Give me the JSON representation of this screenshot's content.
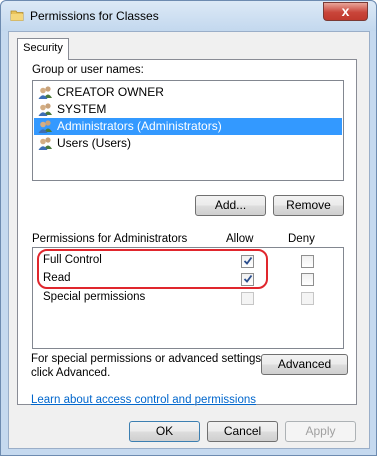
{
  "window": {
    "title": "Permissions for Classes",
    "close_label": "x"
  },
  "tabs": [
    {
      "label": "Security",
      "selected": true
    }
  ],
  "group_list": {
    "label": "Group or user names:",
    "items": [
      {
        "name": "CREATOR OWNER",
        "icon": "users-icon",
        "selected": false
      },
      {
        "name": "SYSTEM",
        "icon": "users-icon",
        "selected": false
      },
      {
        "name": "Administrators (Administrators)",
        "icon": "users-icon",
        "selected": true
      },
      {
        "name": "Users (Users)",
        "icon": "users-icon",
        "selected": false
      }
    ]
  },
  "buttons": {
    "add": "Add...",
    "remove": "Remove",
    "advanced": "Advanced",
    "ok": "OK",
    "cancel": "Cancel",
    "apply": "Apply"
  },
  "permissions": {
    "header_label": "Permissions for Administrators",
    "allow_header": "Allow",
    "deny_header": "Deny",
    "rows": [
      {
        "name": "Full Control",
        "allow": true,
        "deny": false,
        "enabled": true
      },
      {
        "name": "Read",
        "allow": true,
        "deny": false,
        "enabled": true
      },
      {
        "name": "Special permissions",
        "allow": false,
        "deny": false,
        "enabled": false
      }
    ]
  },
  "advanced_text": {
    "line1": "For special permissions or advanced settings,",
    "line2": "click Advanced."
  },
  "help_link": "Learn about access control and permissions",
  "colors": {
    "selection": "#3399ff",
    "highlight_box": "#e0262d",
    "link": "#0066cc"
  }
}
